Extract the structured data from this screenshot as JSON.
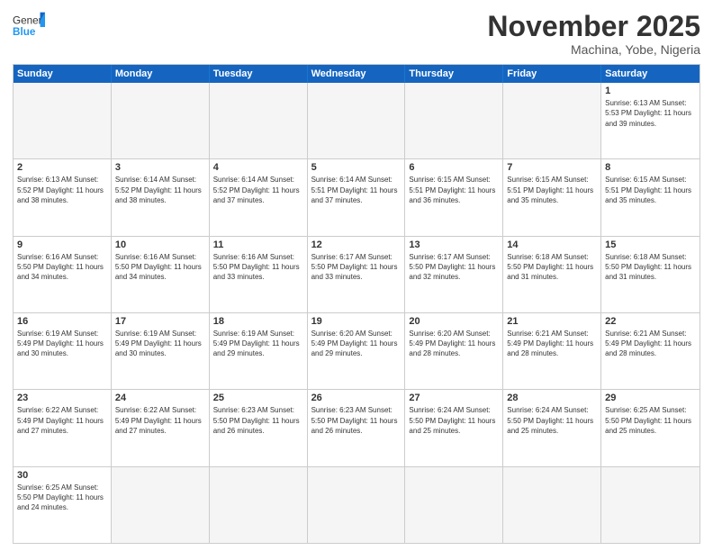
{
  "header": {
    "logo": {
      "general": "General",
      "blue": "Blue"
    },
    "title": "November 2025",
    "location": "Machina, Yobe, Nigeria"
  },
  "dayHeaders": [
    "Sunday",
    "Monday",
    "Tuesday",
    "Wednesday",
    "Thursday",
    "Friday",
    "Saturday"
  ],
  "weeks": [
    [
      {
        "num": "",
        "empty": true,
        "info": ""
      },
      {
        "num": "",
        "empty": true,
        "info": ""
      },
      {
        "num": "",
        "empty": true,
        "info": ""
      },
      {
        "num": "",
        "empty": true,
        "info": ""
      },
      {
        "num": "",
        "empty": true,
        "info": ""
      },
      {
        "num": "",
        "empty": true,
        "info": ""
      },
      {
        "num": "1",
        "empty": false,
        "info": "Sunrise: 6:13 AM\nSunset: 5:53 PM\nDaylight: 11 hours\nand 39 minutes."
      }
    ],
    [
      {
        "num": "2",
        "empty": false,
        "info": "Sunrise: 6:13 AM\nSunset: 5:52 PM\nDaylight: 11 hours\nand 38 minutes."
      },
      {
        "num": "3",
        "empty": false,
        "info": "Sunrise: 6:14 AM\nSunset: 5:52 PM\nDaylight: 11 hours\nand 38 minutes."
      },
      {
        "num": "4",
        "empty": false,
        "info": "Sunrise: 6:14 AM\nSunset: 5:52 PM\nDaylight: 11 hours\nand 37 minutes."
      },
      {
        "num": "5",
        "empty": false,
        "info": "Sunrise: 6:14 AM\nSunset: 5:51 PM\nDaylight: 11 hours\nand 37 minutes."
      },
      {
        "num": "6",
        "empty": false,
        "info": "Sunrise: 6:15 AM\nSunset: 5:51 PM\nDaylight: 11 hours\nand 36 minutes."
      },
      {
        "num": "7",
        "empty": false,
        "info": "Sunrise: 6:15 AM\nSunset: 5:51 PM\nDaylight: 11 hours\nand 35 minutes."
      },
      {
        "num": "8",
        "empty": false,
        "info": "Sunrise: 6:15 AM\nSunset: 5:51 PM\nDaylight: 11 hours\nand 35 minutes."
      }
    ],
    [
      {
        "num": "9",
        "empty": false,
        "info": "Sunrise: 6:16 AM\nSunset: 5:50 PM\nDaylight: 11 hours\nand 34 minutes."
      },
      {
        "num": "10",
        "empty": false,
        "info": "Sunrise: 6:16 AM\nSunset: 5:50 PM\nDaylight: 11 hours\nand 34 minutes."
      },
      {
        "num": "11",
        "empty": false,
        "info": "Sunrise: 6:16 AM\nSunset: 5:50 PM\nDaylight: 11 hours\nand 33 minutes."
      },
      {
        "num": "12",
        "empty": false,
        "info": "Sunrise: 6:17 AM\nSunset: 5:50 PM\nDaylight: 11 hours\nand 33 minutes."
      },
      {
        "num": "13",
        "empty": false,
        "info": "Sunrise: 6:17 AM\nSunset: 5:50 PM\nDaylight: 11 hours\nand 32 minutes."
      },
      {
        "num": "14",
        "empty": false,
        "info": "Sunrise: 6:18 AM\nSunset: 5:50 PM\nDaylight: 11 hours\nand 31 minutes."
      },
      {
        "num": "15",
        "empty": false,
        "info": "Sunrise: 6:18 AM\nSunset: 5:50 PM\nDaylight: 11 hours\nand 31 minutes."
      }
    ],
    [
      {
        "num": "16",
        "empty": false,
        "info": "Sunrise: 6:19 AM\nSunset: 5:49 PM\nDaylight: 11 hours\nand 30 minutes."
      },
      {
        "num": "17",
        "empty": false,
        "info": "Sunrise: 6:19 AM\nSunset: 5:49 PM\nDaylight: 11 hours\nand 30 minutes."
      },
      {
        "num": "18",
        "empty": false,
        "info": "Sunrise: 6:19 AM\nSunset: 5:49 PM\nDaylight: 11 hours\nand 29 minutes."
      },
      {
        "num": "19",
        "empty": false,
        "info": "Sunrise: 6:20 AM\nSunset: 5:49 PM\nDaylight: 11 hours\nand 29 minutes."
      },
      {
        "num": "20",
        "empty": false,
        "info": "Sunrise: 6:20 AM\nSunset: 5:49 PM\nDaylight: 11 hours\nand 28 minutes."
      },
      {
        "num": "21",
        "empty": false,
        "info": "Sunrise: 6:21 AM\nSunset: 5:49 PM\nDaylight: 11 hours\nand 28 minutes."
      },
      {
        "num": "22",
        "empty": false,
        "info": "Sunrise: 6:21 AM\nSunset: 5:49 PM\nDaylight: 11 hours\nand 28 minutes."
      }
    ],
    [
      {
        "num": "23",
        "empty": false,
        "info": "Sunrise: 6:22 AM\nSunset: 5:49 PM\nDaylight: 11 hours\nand 27 minutes."
      },
      {
        "num": "24",
        "empty": false,
        "info": "Sunrise: 6:22 AM\nSunset: 5:49 PM\nDaylight: 11 hours\nand 27 minutes."
      },
      {
        "num": "25",
        "empty": false,
        "info": "Sunrise: 6:23 AM\nSunset: 5:50 PM\nDaylight: 11 hours\nand 26 minutes."
      },
      {
        "num": "26",
        "empty": false,
        "info": "Sunrise: 6:23 AM\nSunset: 5:50 PM\nDaylight: 11 hours\nand 26 minutes."
      },
      {
        "num": "27",
        "empty": false,
        "info": "Sunrise: 6:24 AM\nSunset: 5:50 PM\nDaylight: 11 hours\nand 25 minutes."
      },
      {
        "num": "28",
        "empty": false,
        "info": "Sunrise: 6:24 AM\nSunset: 5:50 PM\nDaylight: 11 hours\nand 25 minutes."
      },
      {
        "num": "29",
        "empty": false,
        "info": "Sunrise: 6:25 AM\nSunset: 5:50 PM\nDaylight: 11 hours\nand 25 minutes."
      }
    ],
    [
      {
        "num": "30",
        "empty": false,
        "info": "Sunrise: 6:25 AM\nSunset: 5:50 PM\nDaylight: 11 hours\nand 24 minutes."
      },
      {
        "num": "",
        "empty": true,
        "info": ""
      },
      {
        "num": "",
        "empty": true,
        "info": ""
      },
      {
        "num": "",
        "empty": true,
        "info": ""
      },
      {
        "num": "",
        "empty": true,
        "info": ""
      },
      {
        "num": "",
        "empty": true,
        "info": ""
      },
      {
        "num": "",
        "empty": true,
        "info": ""
      }
    ]
  ]
}
